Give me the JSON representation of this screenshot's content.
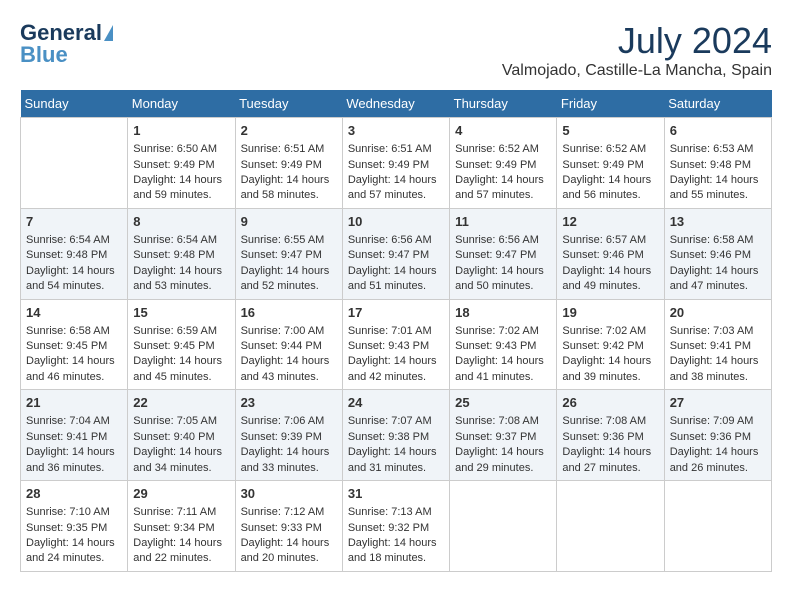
{
  "header": {
    "logo_general": "General",
    "logo_blue": "Blue",
    "month_year": "July 2024",
    "location": "Valmojado, Castille-La Mancha, Spain"
  },
  "days_of_week": [
    "Sunday",
    "Monday",
    "Tuesday",
    "Wednesday",
    "Thursday",
    "Friday",
    "Saturday"
  ],
  "weeks": [
    [
      {
        "day": "",
        "content": ""
      },
      {
        "day": "1",
        "sunrise": "Sunrise: 6:50 AM",
        "sunset": "Sunset: 9:49 PM",
        "daylight": "Daylight: 14 hours and 59 minutes."
      },
      {
        "day": "2",
        "sunrise": "Sunrise: 6:51 AM",
        "sunset": "Sunset: 9:49 PM",
        "daylight": "Daylight: 14 hours and 58 minutes."
      },
      {
        "day": "3",
        "sunrise": "Sunrise: 6:51 AM",
        "sunset": "Sunset: 9:49 PM",
        "daylight": "Daylight: 14 hours and 57 minutes."
      },
      {
        "day": "4",
        "sunrise": "Sunrise: 6:52 AM",
        "sunset": "Sunset: 9:49 PM",
        "daylight": "Daylight: 14 hours and 57 minutes."
      },
      {
        "day": "5",
        "sunrise": "Sunrise: 6:52 AM",
        "sunset": "Sunset: 9:49 PM",
        "daylight": "Daylight: 14 hours and 56 minutes."
      },
      {
        "day": "6",
        "sunrise": "Sunrise: 6:53 AM",
        "sunset": "Sunset: 9:48 PM",
        "daylight": "Daylight: 14 hours and 55 minutes."
      }
    ],
    [
      {
        "day": "7",
        "sunrise": "Sunrise: 6:54 AM",
        "sunset": "Sunset: 9:48 PM",
        "daylight": "Daylight: 14 hours and 54 minutes."
      },
      {
        "day": "8",
        "sunrise": "Sunrise: 6:54 AM",
        "sunset": "Sunset: 9:48 PM",
        "daylight": "Daylight: 14 hours and 53 minutes."
      },
      {
        "day": "9",
        "sunrise": "Sunrise: 6:55 AM",
        "sunset": "Sunset: 9:47 PM",
        "daylight": "Daylight: 14 hours and 52 minutes."
      },
      {
        "day": "10",
        "sunrise": "Sunrise: 6:56 AM",
        "sunset": "Sunset: 9:47 PM",
        "daylight": "Daylight: 14 hours and 51 minutes."
      },
      {
        "day": "11",
        "sunrise": "Sunrise: 6:56 AM",
        "sunset": "Sunset: 9:47 PM",
        "daylight": "Daylight: 14 hours and 50 minutes."
      },
      {
        "day": "12",
        "sunrise": "Sunrise: 6:57 AM",
        "sunset": "Sunset: 9:46 PM",
        "daylight": "Daylight: 14 hours and 49 minutes."
      },
      {
        "day": "13",
        "sunrise": "Sunrise: 6:58 AM",
        "sunset": "Sunset: 9:46 PM",
        "daylight": "Daylight: 14 hours and 47 minutes."
      }
    ],
    [
      {
        "day": "14",
        "sunrise": "Sunrise: 6:58 AM",
        "sunset": "Sunset: 9:45 PM",
        "daylight": "Daylight: 14 hours and 46 minutes."
      },
      {
        "day": "15",
        "sunrise": "Sunrise: 6:59 AM",
        "sunset": "Sunset: 9:45 PM",
        "daylight": "Daylight: 14 hours and 45 minutes."
      },
      {
        "day": "16",
        "sunrise": "Sunrise: 7:00 AM",
        "sunset": "Sunset: 9:44 PM",
        "daylight": "Daylight: 14 hours and 43 minutes."
      },
      {
        "day": "17",
        "sunrise": "Sunrise: 7:01 AM",
        "sunset": "Sunset: 9:43 PM",
        "daylight": "Daylight: 14 hours and 42 minutes."
      },
      {
        "day": "18",
        "sunrise": "Sunrise: 7:02 AM",
        "sunset": "Sunset: 9:43 PM",
        "daylight": "Daylight: 14 hours and 41 minutes."
      },
      {
        "day": "19",
        "sunrise": "Sunrise: 7:02 AM",
        "sunset": "Sunset: 9:42 PM",
        "daylight": "Daylight: 14 hours and 39 minutes."
      },
      {
        "day": "20",
        "sunrise": "Sunrise: 7:03 AM",
        "sunset": "Sunset: 9:41 PM",
        "daylight": "Daylight: 14 hours and 38 minutes."
      }
    ],
    [
      {
        "day": "21",
        "sunrise": "Sunrise: 7:04 AM",
        "sunset": "Sunset: 9:41 PM",
        "daylight": "Daylight: 14 hours and 36 minutes."
      },
      {
        "day": "22",
        "sunrise": "Sunrise: 7:05 AM",
        "sunset": "Sunset: 9:40 PM",
        "daylight": "Daylight: 14 hours and 34 minutes."
      },
      {
        "day": "23",
        "sunrise": "Sunrise: 7:06 AM",
        "sunset": "Sunset: 9:39 PM",
        "daylight": "Daylight: 14 hours and 33 minutes."
      },
      {
        "day": "24",
        "sunrise": "Sunrise: 7:07 AM",
        "sunset": "Sunset: 9:38 PM",
        "daylight": "Daylight: 14 hours and 31 minutes."
      },
      {
        "day": "25",
        "sunrise": "Sunrise: 7:08 AM",
        "sunset": "Sunset: 9:37 PM",
        "daylight": "Daylight: 14 hours and 29 minutes."
      },
      {
        "day": "26",
        "sunrise": "Sunrise: 7:08 AM",
        "sunset": "Sunset: 9:36 PM",
        "daylight": "Daylight: 14 hours and 27 minutes."
      },
      {
        "day": "27",
        "sunrise": "Sunrise: 7:09 AM",
        "sunset": "Sunset: 9:36 PM",
        "daylight": "Daylight: 14 hours and 26 minutes."
      }
    ],
    [
      {
        "day": "28",
        "sunrise": "Sunrise: 7:10 AM",
        "sunset": "Sunset: 9:35 PM",
        "daylight": "Daylight: 14 hours and 24 minutes."
      },
      {
        "day": "29",
        "sunrise": "Sunrise: 7:11 AM",
        "sunset": "Sunset: 9:34 PM",
        "daylight": "Daylight: 14 hours and 22 minutes."
      },
      {
        "day": "30",
        "sunrise": "Sunrise: 7:12 AM",
        "sunset": "Sunset: 9:33 PM",
        "daylight": "Daylight: 14 hours and 20 minutes."
      },
      {
        "day": "31",
        "sunrise": "Sunrise: 7:13 AM",
        "sunset": "Sunset: 9:32 PM",
        "daylight": "Daylight: 14 hours and 18 minutes."
      },
      {
        "day": "",
        "content": ""
      },
      {
        "day": "",
        "content": ""
      },
      {
        "day": "",
        "content": ""
      }
    ]
  ]
}
